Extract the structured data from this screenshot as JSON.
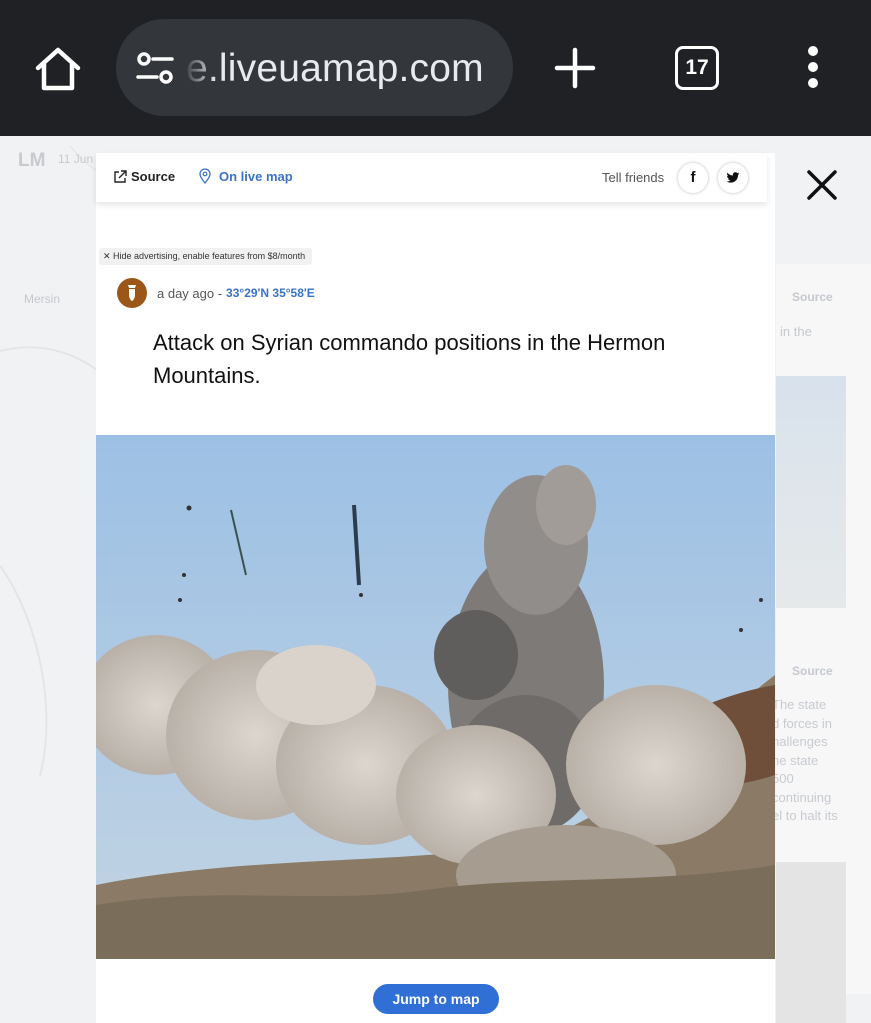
{
  "browser": {
    "url_display": "e.liveuamap.com",
    "tab_count": "17",
    "icons": [
      "home-icon",
      "tune-icon",
      "new-tab-plus-icon",
      "tab-switcher-icon",
      "more-vert-icon"
    ]
  },
  "background_page": {
    "logo": "LM",
    "date": "11 Jun",
    "city_label": "Mersin",
    "side_source_1": "Source",
    "side_snippet": "in the",
    "side_source_2": "Source",
    "side_text_lines": [
      "The state",
      "d forces in",
      "hallenges",
      "he state",
      "500",
      "continuing",
      "el to halt its"
    ]
  },
  "modal": {
    "source_label": "Source",
    "live_map_label": "On live map",
    "tell_friends_label": "Tell friends",
    "facebook_glyph": "f",
    "ad_note": "✕ Hide advertising, enable features from $8/month",
    "time_ago": "a day ago -",
    "coordinates": "33°29'N 35°58'E",
    "title": "Attack on Syrian commando positions in the Hermon Mountains.",
    "jump_label": "Jump to map",
    "colors": {
      "accent": "#2f6fd6",
      "link": "#3a73c9",
      "category": "#9c5618"
    }
  }
}
